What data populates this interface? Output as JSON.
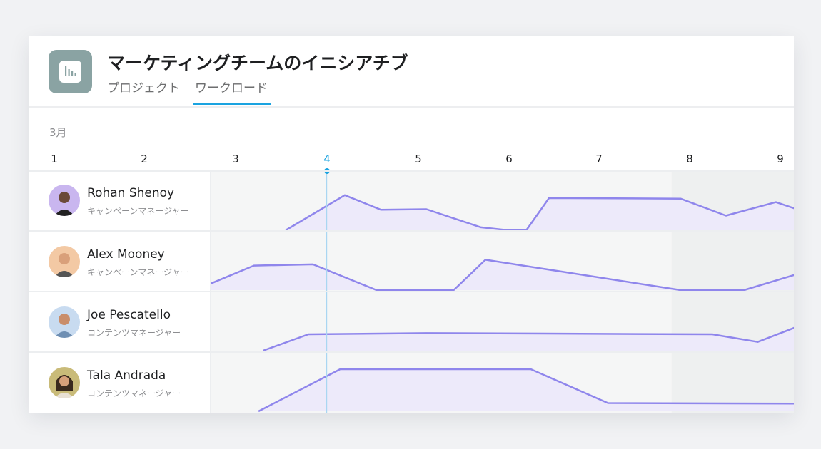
{
  "header": {
    "title": "マーケティングチームのイニシアチブ",
    "tabs": [
      "プロジェクト",
      "ワークロード"
    ],
    "active_tab": "ワークロード",
    "app_icon": "bar-chart-icon"
  },
  "timeline": {
    "month": "3月",
    "days": [
      "1",
      "2",
      "3",
      "4",
      "5",
      "6",
      "7",
      "8",
      "9"
    ],
    "today": "4"
  },
  "people": [
    {
      "name": "Rohan Shenoy",
      "role": "キャンペーンマネージャー",
      "avatar_bg": "#c9b6ef",
      "workload": [
        [
          3.55,
          0
        ],
        [
          4.2,
          0.6
        ],
        [
          4.6,
          0.35
        ],
        [
          5.1,
          0.36
        ],
        [
          5.7,
          0.05
        ],
        [
          6.0,
          0
        ],
        [
          6.2,
          0
        ],
        [
          6.45,
          0.55
        ],
        [
          7.9,
          0.54
        ],
        [
          8.4,
          0.25
        ],
        [
          8.95,
          0.48
        ],
        [
          9.2,
          0.35
        ]
      ]
    },
    {
      "name": "Alex Mooney",
      "role": "キャンペーンマネージャー",
      "avatar_bg": "#f3c9a4",
      "workload": [
        [
          2.55,
          0
        ],
        [
          3.2,
          0.42
        ],
        [
          3.85,
          0.44
        ],
        [
          4.55,
          0
        ],
        [
          5.4,
          0
        ],
        [
          5.75,
          0.52
        ],
        [
          7.9,
          0
        ],
        [
          8.6,
          0
        ],
        [
          9.2,
          0.28
        ]
      ]
    },
    {
      "name": "Joe Pescatello",
      "role": "コンテンツマネージャー",
      "avatar_bg": "#c8dbf0",
      "workload": [
        [
          3.3,
          0
        ],
        [
          3.8,
          0.28
        ],
        [
          5.1,
          0.3
        ],
        [
          8.25,
          0.28
        ],
        [
          8.75,
          0.15
        ],
        [
          9.2,
          0.42
        ]
      ]
    },
    {
      "name": "Tala Andrada",
      "role": "コンテンツマネージャー",
      "avatar_bg": "#c9bb79",
      "workload": [
        [
          3.25,
          0
        ],
        [
          4.15,
          0.72
        ],
        [
          6.25,
          0.72
        ],
        [
          7.1,
          0.14
        ],
        [
          9.2,
          0.13
        ]
      ]
    }
  ],
  "colors": {
    "accent": "#1aa3e0",
    "workload_line": "#8f86ec",
    "workload_fill": "#ece9fb",
    "weekday_bg": "#f5f6f6",
    "weekend_bg": "#eef0f0"
  }
}
